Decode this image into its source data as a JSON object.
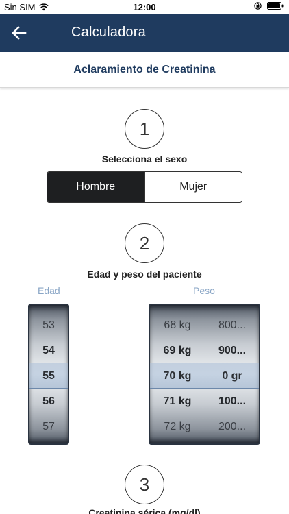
{
  "status_bar": {
    "carrier": "Sin SIM",
    "time": "12:00"
  },
  "nav": {
    "title": "Calculadora"
  },
  "sub_header": {
    "title": "Aclaramiento de Creatinina"
  },
  "step1": {
    "number": "1",
    "label": "Selecciona el sexo",
    "options": [
      "Hombre",
      "Mujer"
    ],
    "selected": "Hombre"
  },
  "step2": {
    "number": "2",
    "label": "Edad y peso del paciente",
    "age_label": "Edad",
    "weight_label": "Peso",
    "age_values": [
      "53",
      "54",
      "55",
      "56",
      "57"
    ],
    "age_selected": "55",
    "kg_values": [
      "68 kg",
      "69 kg",
      "70 kg",
      "71 kg",
      "72 kg"
    ],
    "kg_selected": "70 kg",
    "gr_values": [
      "800...",
      "900...",
      "0 gr",
      "100...",
      "200..."
    ],
    "gr_selected": "0 gr"
  },
  "step3": {
    "number": "3",
    "label": "Creatinina sérica (mg/dl)"
  },
  "colors": {
    "nav_bg": "#1f3b5f",
    "accent": "#1f3b5f",
    "picker_label": "#8aa6c6",
    "segment_active": "#1e1f21"
  }
}
